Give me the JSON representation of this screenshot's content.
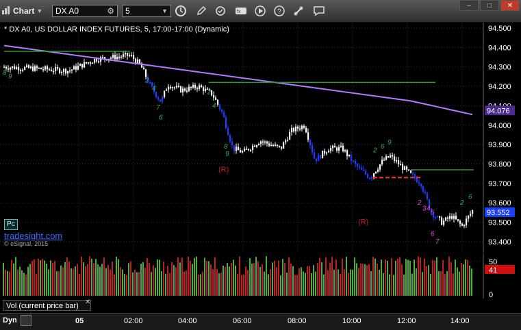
{
  "toolbar": {
    "chart_label": "Chart",
    "symbol": "DX A0",
    "interval": "5"
  },
  "chart": {
    "title": "* DX A0, US DOLLAR INDEX FUTURES, 5, 17:00-17:00 (Dynamic)",
    "pc_badge": "Pc",
    "watermark_link": "tradesight.com",
    "copyright": "© eSignal, 2015",
    "price_ticks": [
      "94.500",
      "94.400",
      "94.300",
      "94.200",
      "94.100",
      "94.000",
      "93.900",
      "93.800",
      "93.700",
      "93.600",
      "93.500",
      "93.400"
    ],
    "ma_label": "94.076",
    "last_price_label": "93.552",
    "markers": {
      "r1": "(R)",
      "r2": "(R)"
    },
    "colors": {
      "up": "#ffffff",
      "down": "#1f3cff",
      "ma": "#b07cff",
      "level": "#2e9b2e",
      "support": "#ff3030",
      "counts_green": "#2fae5a",
      "counts_magenta": "#e043e0",
      "r_marker": "#c0202a"
    }
  },
  "volume": {
    "label": "Vol (current price bar)",
    "ticks": [
      "50",
      "41",
      "0"
    ]
  },
  "time_axis": {
    "dyn": "Dyn",
    "labels": [
      "05",
      "02:00",
      "04:00",
      "06:00",
      "08:00",
      "10:00",
      "12:00",
      "14:00"
    ]
  }
}
